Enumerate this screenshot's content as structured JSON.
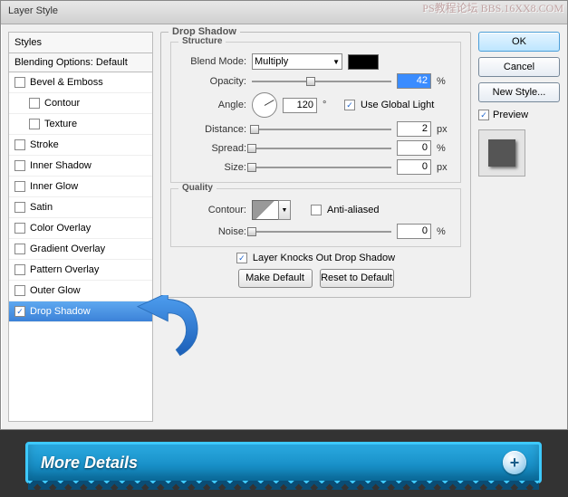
{
  "title": "Layer Style",
  "watermark": "PS教程论坛\nBBS.16XX8.COM",
  "sidebar": {
    "head": "Styles",
    "sub": "Blending Options: Default",
    "items": [
      {
        "label": "Bevel & Emboss",
        "checked": false,
        "indent": false
      },
      {
        "label": "Contour",
        "checked": false,
        "indent": true
      },
      {
        "label": "Texture",
        "checked": false,
        "indent": true
      },
      {
        "label": "Stroke",
        "checked": false,
        "indent": false
      },
      {
        "label": "Inner Shadow",
        "checked": false,
        "indent": false
      },
      {
        "label": "Inner Glow",
        "checked": false,
        "indent": false
      },
      {
        "label": "Satin",
        "checked": false,
        "indent": false
      },
      {
        "label": "Color Overlay",
        "checked": false,
        "indent": false
      },
      {
        "label": "Gradient Overlay",
        "checked": false,
        "indent": false
      },
      {
        "label": "Pattern Overlay",
        "checked": false,
        "indent": false
      },
      {
        "label": "Outer Glow",
        "checked": false,
        "indent": false
      },
      {
        "label": "Drop Shadow",
        "checked": true,
        "indent": false,
        "selected": true
      }
    ]
  },
  "main": {
    "heading": "Drop Shadow",
    "structure": {
      "legend": "Structure",
      "blend_mode_label": "Blend Mode:",
      "blend_mode_value": "Multiply",
      "opacity_label": "Opacity:",
      "opacity_value": "42",
      "opacity_unit": "%",
      "angle_label": "Angle:",
      "angle_value": "120",
      "angle_unit": "°",
      "use_global_label": "Use Global Light",
      "use_global_checked": true,
      "distance_label": "Distance:",
      "distance_value": "2",
      "distance_unit": "px",
      "spread_label": "Spread:",
      "spread_value": "0",
      "spread_unit": "%",
      "size_label": "Size:",
      "size_value": "0",
      "size_unit": "px"
    },
    "quality": {
      "legend": "Quality",
      "contour_label": "Contour:",
      "antialiased_label": "Anti-aliased",
      "antialiased_checked": false,
      "noise_label": "Noise:",
      "noise_value": "0",
      "noise_unit": "%"
    },
    "knockout_label": "Layer Knocks Out Drop Shadow",
    "knockout_checked": true,
    "make_default": "Make Default",
    "reset_default": "Reset to Default"
  },
  "right": {
    "ok": "OK",
    "cancel": "Cancel",
    "newstyle": "New Style...",
    "preview_label": "Preview",
    "preview_checked": true
  },
  "banner": {
    "text": "More Details",
    "icon": "plus-icon"
  }
}
